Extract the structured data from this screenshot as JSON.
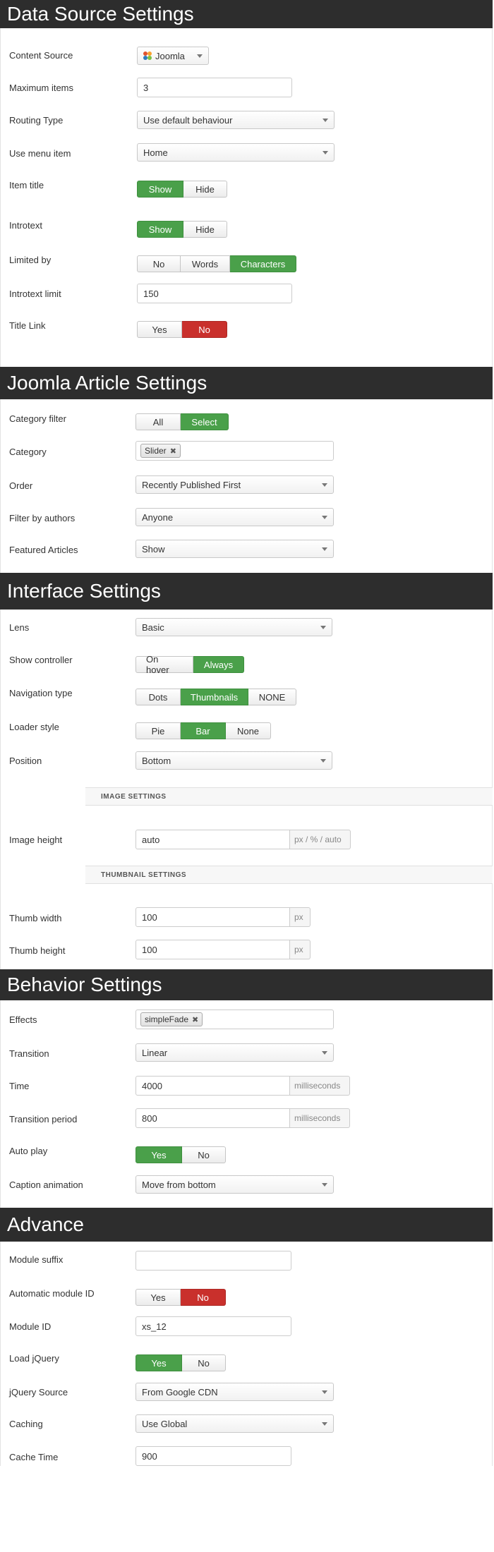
{
  "sections": {
    "data_source": "Data Source Settings",
    "joomla_article": "Joomla Article Settings",
    "interface": "Interface Settings",
    "behavior": "Behavior Settings",
    "advance": "Advance"
  },
  "data_source": {
    "content_source": {
      "label": "Content Source",
      "value": "Joomla"
    },
    "maximum_items": {
      "label": "Maximum items",
      "value": "3"
    },
    "routing_type": {
      "label": "Routing Type",
      "value": "Use default behaviour"
    },
    "use_menu_item": {
      "label": "Use menu item",
      "value": "Home"
    },
    "item_title": {
      "label": "Item title",
      "options": [
        "Show",
        "Hide"
      ],
      "selected": "Show"
    },
    "introtext": {
      "label": "Introtext",
      "options": [
        "Show",
        "Hide"
      ],
      "selected": "Show"
    },
    "limited_by": {
      "label": "Limited by",
      "options": [
        "No",
        "Words",
        "Characters"
      ],
      "selected": "Characters"
    },
    "introtext_limit": {
      "label": "Introtext limit",
      "value": "150"
    },
    "title_link": {
      "label": "Title Link",
      "options": [
        "Yes",
        "No"
      ],
      "selected": "No"
    }
  },
  "joomla_article": {
    "category_filter": {
      "label": "Category filter",
      "options": [
        "All",
        "Select"
      ],
      "selected": "Select"
    },
    "category": {
      "label": "Category",
      "tag": "Slider"
    },
    "order": {
      "label": "Order",
      "value": "Recently Published First"
    },
    "filter_by_authors": {
      "label": "Filter by authors",
      "value": "Anyone"
    },
    "featured_articles": {
      "label": "Featured Articles",
      "value": "Show"
    }
  },
  "interface": {
    "lens": {
      "label": "Lens",
      "value": "Basic"
    },
    "show_controller": {
      "label": "Show controller",
      "options": [
        "On hover",
        "Always"
      ],
      "selected": "Always"
    },
    "navigation_type": {
      "label": "Navigation type",
      "options": [
        "Dots",
        "Thumbnails",
        "NONE"
      ],
      "selected": "Thumbnails"
    },
    "loader_style": {
      "label": "Loader style",
      "options": [
        "Pie",
        "Bar",
        "None"
      ],
      "selected": "Bar"
    },
    "position": {
      "label": "Position",
      "value": "Bottom"
    },
    "image_settings": "IMAGE SETTINGS",
    "image_height": {
      "label": "Image height",
      "value": "auto",
      "addon": "px / % / auto"
    },
    "thumbnail_settings": "THUMBNAIL SETTINGS",
    "thumb_width": {
      "label": "Thumb width",
      "value": "100",
      "addon": "px"
    },
    "thumb_height": {
      "label": "Thumb height",
      "value": "100",
      "addon": "px"
    }
  },
  "behavior": {
    "effects": {
      "label": "Effects",
      "tag": "simpleFade"
    },
    "transition": {
      "label": "Transition",
      "value": "Linear"
    },
    "time": {
      "label": "Time",
      "value": "4000",
      "addon": "milliseconds"
    },
    "transition_period": {
      "label": "Transition period",
      "value": "800",
      "addon": "milliseconds"
    },
    "auto_play": {
      "label": "Auto play",
      "options": [
        "Yes",
        "No"
      ],
      "selected": "Yes"
    },
    "caption_animation": {
      "label": "Caption animation",
      "value": "Move from bottom"
    }
  },
  "advance": {
    "module_suffix": {
      "label": "Module suffix",
      "value": ""
    },
    "automatic_module_id": {
      "label": "Automatic module ID",
      "options": [
        "Yes",
        "No"
      ],
      "selected": "No"
    },
    "module_id": {
      "label": "Module ID",
      "value": "xs_12"
    },
    "load_jquery": {
      "label": "Load jQuery",
      "options": [
        "Yes",
        "No"
      ],
      "selected": "Yes"
    },
    "jquery_source": {
      "label": "jQuery Source",
      "value": "From Google CDN"
    },
    "caching": {
      "label": "Caching",
      "value": "Use Global"
    },
    "cache_time": {
      "label": "Cache Time",
      "value": "900"
    }
  },
  "colors": {
    "header_bg": "#2d2d2d",
    "active_green": "#4aa04a",
    "active_red": "#c9302c"
  }
}
